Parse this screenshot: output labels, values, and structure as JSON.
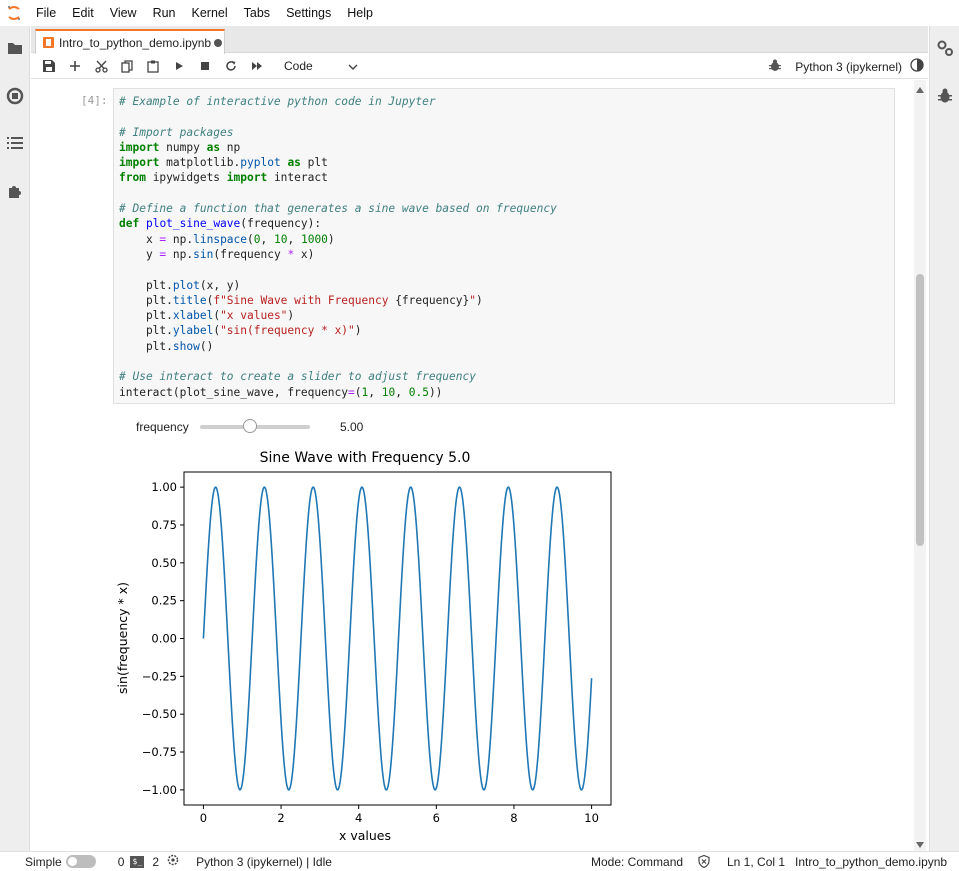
{
  "menu": [
    "File",
    "Edit",
    "View",
    "Run",
    "Kernel",
    "Tabs",
    "Settings",
    "Help"
  ],
  "tab": {
    "title": "Intro_to_python_demo.ipynb"
  },
  "toolbar": {
    "cell_type": "Code",
    "kernel_name": "Python 3 (ipykernel)"
  },
  "cell": {
    "prompt": "[4]:",
    "lines": [
      [
        {
          "t": "# Example of interactive python code in Jupyter",
          "c": "com"
        }
      ],
      [],
      [
        {
          "t": "# Import packages",
          "c": "com"
        }
      ],
      [
        {
          "t": "import",
          "c": "kw"
        },
        {
          "t": " numpy ",
          "c": ""
        },
        {
          "t": "as",
          "c": "kw"
        },
        {
          "t": " np",
          "c": ""
        }
      ],
      [
        {
          "t": "import",
          "c": "kw"
        },
        {
          "t": " matplotlib",
          "c": ""
        },
        {
          "t": ".",
          "c": ""
        },
        {
          "t": "pyplot",
          "c": "prop"
        },
        {
          "t": " ",
          "c": ""
        },
        {
          "t": "as",
          "c": "kw"
        },
        {
          "t": " plt",
          "c": ""
        }
      ],
      [
        {
          "t": "from",
          "c": "kw"
        },
        {
          "t": " ipywidgets ",
          "c": ""
        },
        {
          "t": "import",
          "c": "kw"
        },
        {
          "t": " interact",
          "c": ""
        }
      ],
      [],
      [
        {
          "t": "# Define a function that generates a sine wave based on frequency",
          "c": "com"
        }
      ],
      [
        {
          "t": "def",
          "c": "kw"
        },
        {
          "t": " ",
          "c": ""
        },
        {
          "t": "plot_sine_wave",
          "c": "fn"
        },
        {
          "t": "(frequency):",
          "c": ""
        }
      ],
      [
        {
          "t": "    x ",
          "c": ""
        },
        {
          "t": "=",
          "c": "op"
        },
        {
          "t": " np.",
          "c": ""
        },
        {
          "t": "linspace",
          "c": "prop"
        },
        {
          "t": "(",
          "c": ""
        },
        {
          "t": "0",
          "c": "num"
        },
        {
          "t": ", ",
          "c": ""
        },
        {
          "t": "10",
          "c": "num"
        },
        {
          "t": ", ",
          "c": ""
        },
        {
          "t": "1000",
          "c": "num"
        },
        {
          "t": ")",
          "c": ""
        }
      ],
      [
        {
          "t": "    y ",
          "c": ""
        },
        {
          "t": "=",
          "c": "op"
        },
        {
          "t": " np.",
          "c": ""
        },
        {
          "t": "sin",
          "c": "prop"
        },
        {
          "t": "(frequency ",
          "c": ""
        },
        {
          "t": "*",
          "c": "op"
        },
        {
          "t": " x)",
          "c": ""
        }
      ],
      [],
      [
        {
          "t": "    plt.",
          "c": ""
        },
        {
          "t": "plot",
          "c": "prop"
        },
        {
          "t": "(x, y)",
          "c": ""
        }
      ],
      [
        {
          "t": "    plt.",
          "c": ""
        },
        {
          "t": "title",
          "c": "prop"
        },
        {
          "t": "(",
          "c": ""
        },
        {
          "t": "f\"Sine Wave with Frequency ",
          "c": "str"
        },
        {
          "t": "{frequency}",
          "c": ""
        },
        {
          "t": "\"",
          "c": "str"
        },
        {
          "t": ")",
          "c": ""
        }
      ],
      [
        {
          "t": "    plt.",
          "c": ""
        },
        {
          "t": "xlabel",
          "c": "prop"
        },
        {
          "t": "(",
          "c": ""
        },
        {
          "t": "\"x values\"",
          "c": "str"
        },
        {
          "t": ")",
          "c": ""
        }
      ],
      [
        {
          "t": "    plt.",
          "c": ""
        },
        {
          "t": "ylabel",
          "c": "prop"
        },
        {
          "t": "(",
          "c": ""
        },
        {
          "t": "\"sin(frequency * x)\"",
          "c": "str"
        },
        {
          "t": ")",
          "c": ""
        }
      ],
      [
        {
          "t": "    plt.",
          "c": ""
        },
        {
          "t": "show",
          "c": "prop"
        },
        {
          "t": "()",
          "c": ""
        }
      ],
      [],
      [
        {
          "t": "# Use interact to create a slider to adjust frequency",
          "c": "com"
        }
      ],
      [
        {
          "t": "interact(plot_sine_wave, frequency",
          "c": ""
        },
        {
          "t": "=",
          "c": "op"
        },
        {
          "t": "(",
          "c": ""
        },
        {
          "t": "1",
          "c": "num"
        },
        {
          "t": ", ",
          "c": ""
        },
        {
          "t": "10",
          "c": "num"
        },
        {
          "t": ", ",
          "c": ""
        },
        {
          "t": "0.5",
          "c": "num"
        },
        {
          "t": "))",
          "c": ""
        }
      ]
    ]
  },
  "widget": {
    "label": "frequency",
    "value": "5.00",
    "min": 1,
    "max": 10,
    "current": 5
  },
  "chart_data": {
    "type": "line",
    "title": "Sine Wave with Frequency 5.0",
    "xlabel": "x values",
    "ylabel": "sin(frequency * x)",
    "frequency": 5.0,
    "x_range": [
      0,
      10
    ],
    "xlim": [
      -0.5,
      10.5
    ],
    "ylim": [
      -1.1,
      1.1
    ],
    "xticks": [
      0,
      2,
      4,
      6,
      8,
      10
    ],
    "yticks": [
      1.0,
      0.75,
      0.5,
      0.25,
      0.0,
      -0.25,
      -0.5,
      -0.75,
      -1.0
    ],
    "ytick_labels": [
      "1.00",
      "0.75",
      "0.50",
      "0.25",
      "0.00",
      "−0.25",
      "−0.50",
      "−0.75",
      "−1.00"
    ],
    "series": [
      {
        "color": "#1f77b4",
        "x_start": 0,
        "x_end": 10,
        "y_start": 0.0,
        "y_end": -0.262
      }
    ]
  },
  "status": {
    "mode_label": "Simple",
    "count_a": "0",
    "count_b": "2",
    "kernel_status": "Python 3 (ipykernel) | Idle",
    "mode": "Mode: Command",
    "cursor": "Ln 1, Col 1",
    "filename": "Intro_to_python_demo.ipynb"
  }
}
